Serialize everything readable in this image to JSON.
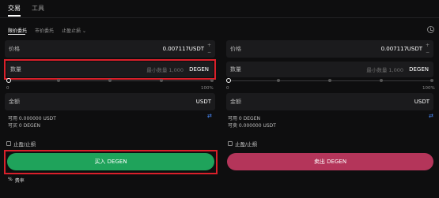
{
  "top_tabs": [
    {
      "label": "交易"
    },
    {
      "label": "工具"
    }
  ],
  "order_tabs": [
    {
      "label": "限价委托"
    },
    {
      "label": "市价委托"
    },
    {
      "label": "止盈止损"
    }
  ],
  "buy": {
    "price_label": "价格",
    "price_value": "0.007117",
    "price_unit": "USDT",
    "qty_label": "数量",
    "qty_placeholder": "最小数量 1,000",
    "qty_unit": "DEGEN",
    "slider_min": "0",
    "slider_max": "100%",
    "total_label": "金额",
    "total_unit": "USDT",
    "available_line": "可用 0.000000 USDT",
    "buyable_line": "可买 0 DEGEN",
    "tp_sl_label": "止盈/止损",
    "button_label": "买入 DEGEN",
    "slider_level": 0
  },
  "sell": {
    "price_label": "价格",
    "price_value": "0.007117",
    "price_unit": "USDT",
    "qty_label": "数量",
    "qty_placeholder": "最小数量 1,000",
    "qty_unit": "DEGEN",
    "slider_min": "0",
    "slider_max": "100%",
    "total_label": "金额",
    "total_unit": "USDT",
    "available_line": "可用 0 DEGEN",
    "sellable_line": "可卖 0.000000 USDT",
    "tp_sl_label": "止盈/止损",
    "button_label": "卖出 DEGEN",
    "slider_level": 0
  },
  "fee_label": "费率",
  "icons": {
    "clock": "clock-icon",
    "swap": "swap-icon",
    "fee": "percent-icon"
  },
  "colors": {
    "buy": "#1fa35b",
    "sell": "#b4355a",
    "highlight": "#d9202a",
    "accent": "#4a8cff"
  }
}
